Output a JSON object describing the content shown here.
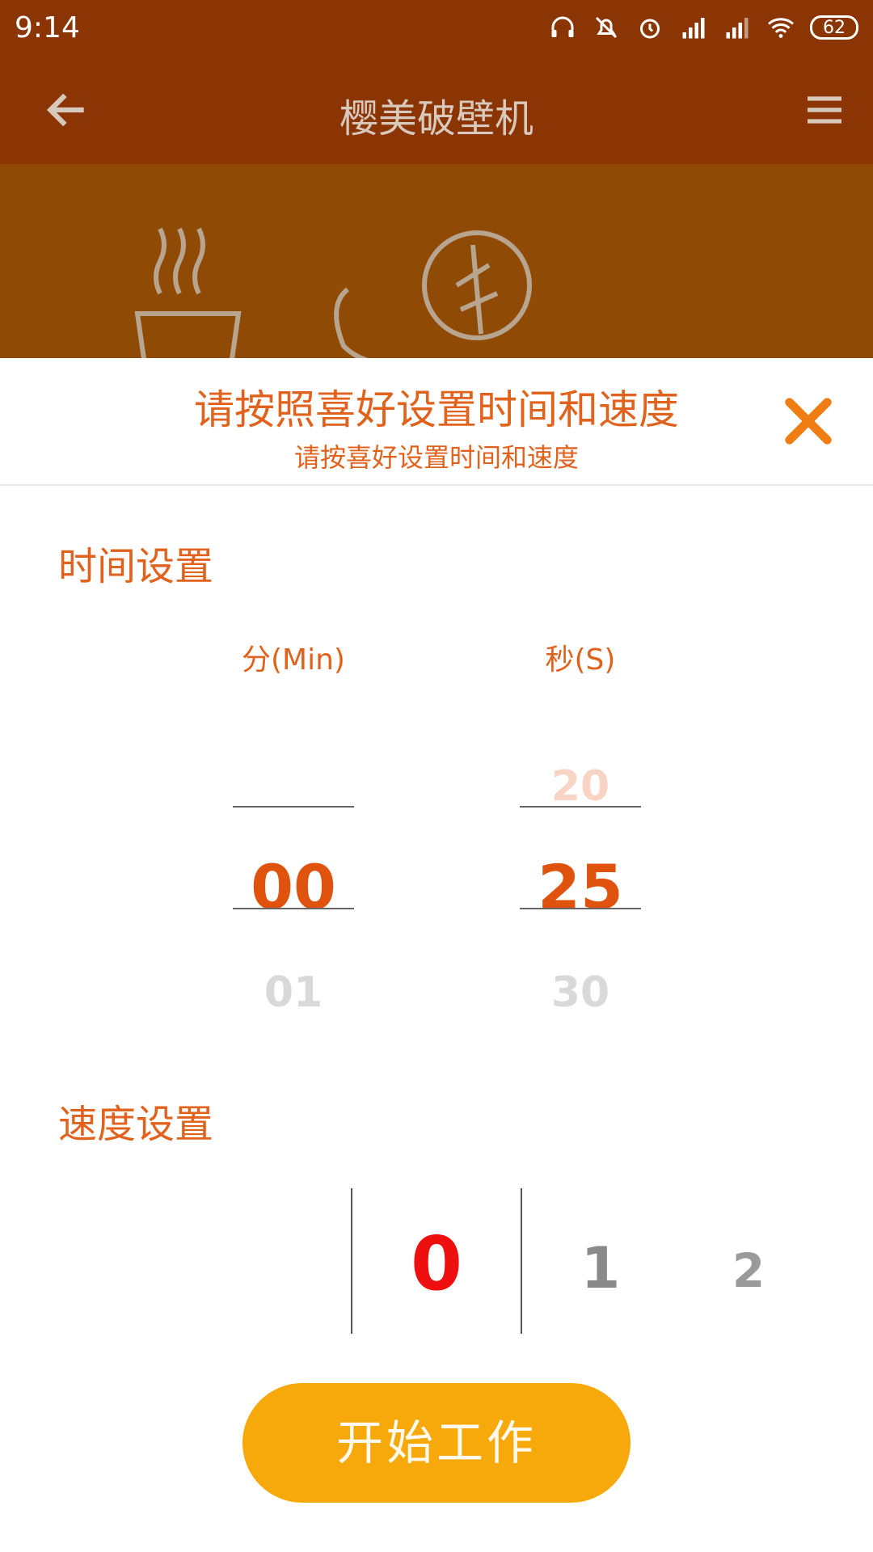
{
  "status_bar": {
    "time": "9:14",
    "battery": "62",
    "icons": [
      "headset-icon",
      "mute-icon",
      "alarm-icon",
      "signal-icon",
      "signal-icon",
      "wifi-icon",
      "battery-icon"
    ]
  },
  "app_bar": {
    "title": "樱美破壁机",
    "back_icon": "arrow-left-icon",
    "menu_icon": "hamburger-menu-icon"
  },
  "sheet": {
    "title": "请按照喜好设置时间和速度",
    "subtitle": "请按喜好设置时间和速度",
    "close_icon": "close-icon"
  },
  "time_setting": {
    "label": "时间设置",
    "minutes": {
      "header": "分(Min)",
      "prev": "",
      "selected": "00",
      "next": "01"
    },
    "seconds": {
      "header": "秒(S)",
      "prev": "20",
      "selected": "25",
      "next": "30"
    }
  },
  "speed_setting": {
    "label": "速度设置",
    "selected": "0",
    "options": [
      "0",
      "1",
      "2"
    ]
  },
  "start_button": {
    "label": "开始工作"
  },
  "colors": {
    "accent": "#e0621d",
    "app_bar": "#8a3503",
    "button": "#f7a90b",
    "speed_selected": "#ee0f0f"
  }
}
